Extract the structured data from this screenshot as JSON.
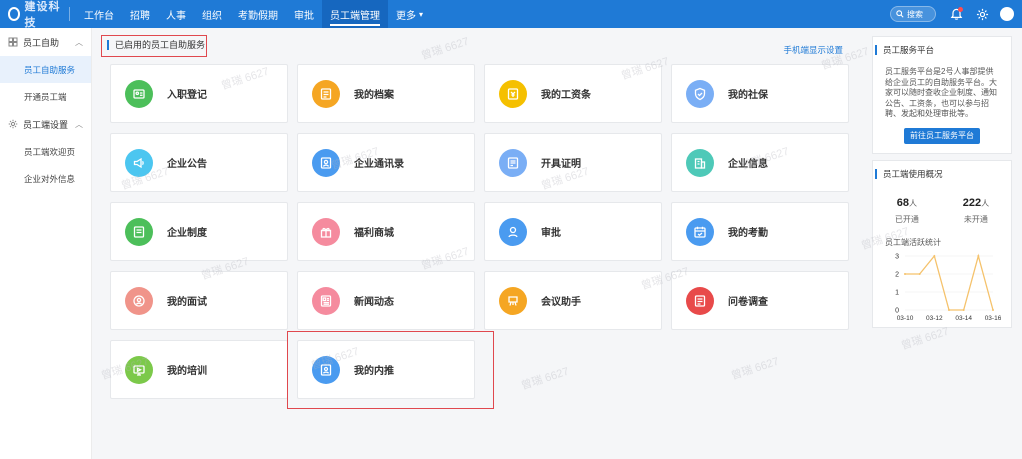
{
  "topbar": {
    "logo_text": "建设科技",
    "nav": [
      {
        "label": "工作台"
      },
      {
        "label": "招聘"
      },
      {
        "label": "人事"
      },
      {
        "label": "组织"
      },
      {
        "label": "考勤假期"
      },
      {
        "label": "审批"
      },
      {
        "label": "员工端管理",
        "active": true
      },
      {
        "label": "更多"
      }
    ],
    "search_label": "搜索"
  },
  "sidebar": {
    "groups": [
      {
        "label": "员工自助",
        "items": [
          "员工自助服务",
          "开通员工端"
        ]
      },
      {
        "label": "员工端设置",
        "items": [
          "员工端欢迎页",
          "企业对外信息"
        ]
      }
    ]
  },
  "main": {
    "section_title": "已启用的员工自助服务",
    "section_link": "手机端显示设置",
    "services": [
      {
        "label": "入职登记",
        "icon": "id-card-icon",
        "color": "#4cbf5a"
      },
      {
        "label": "我的档案",
        "icon": "folder-icon",
        "color": "#f5a623"
      },
      {
        "label": "我的工资条",
        "icon": "payslip-icon",
        "color": "#f5c000"
      },
      {
        "label": "我的社保",
        "icon": "shield-icon",
        "color": "#7aaef5"
      },
      {
        "label": "企业公告",
        "icon": "megaphone-icon",
        "color": "#4cc6f0"
      },
      {
        "label": "企业通讯录",
        "icon": "contacts-icon",
        "color": "#4a9bf0"
      },
      {
        "label": "开具证明",
        "icon": "certificate-icon",
        "color": "#7aaef5"
      },
      {
        "label": "企业信息",
        "icon": "company-icon",
        "color": "#4ec9b8"
      },
      {
        "label": "企业制度",
        "icon": "rules-icon",
        "color": "#4cbf5a"
      },
      {
        "label": "福利商城",
        "icon": "gift-icon",
        "color": "#f58b9e"
      },
      {
        "label": "审批",
        "icon": "approval-icon",
        "color": "#4a9bf0"
      },
      {
        "label": "我的考勤",
        "icon": "calendar-icon",
        "color": "#4a9bf0"
      },
      {
        "label": "我的面试",
        "icon": "interview-icon",
        "color": "#f0948a"
      },
      {
        "label": "新闻动态",
        "icon": "news-icon",
        "color": "#f58b9e"
      },
      {
        "label": "会议助手",
        "icon": "meeting-icon",
        "color": "#f5a623"
      },
      {
        "label": "问卷调查",
        "icon": "survey-icon",
        "color": "#e84a4a"
      },
      {
        "label": "我的培训",
        "icon": "training-icon",
        "color": "#7cc94a"
      },
      {
        "label": "我的内推",
        "icon": "referral-icon",
        "color": "#4a9bf0"
      }
    ]
  },
  "rpanel": {
    "platform": {
      "title": "员工服务平台",
      "desc": "员工服务平台是2号人事部提供给企业员工的自助服务平台。大家可以随时查收企业制度、通知公告、工资条，也可以参与招聘、发起和处理审批等。",
      "button": "前往员工服务平台"
    },
    "usage": {
      "title": "员工端使用概况",
      "opened": {
        "num": "68",
        "unit": "人",
        "label": "已开通"
      },
      "not_opened": {
        "num": "222",
        "unit": "人",
        "label": "未开通"
      },
      "chart_title": "员工端活跃统计"
    }
  },
  "chart_data": {
    "type": "line",
    "x": [
      "03-10",
      "03-11",
      "03-12",
      "03-13",
      "03-14",
      "03-15",
      "03-16"
    ],
    "x_tick_labels": [
      "03-10",
      "03-12",
      "03-14",
      "03-16"
    ],
    "series": [
      {
        "values": [
          2,
          2,
          3,
          0,
          0,
          3,
          0
        ]
      }
    ],
    "ylim": [
      0,
      3
    ],
    "y_ticks": [
      "0",
      "1",
      "2",
      "3"
    ],
    "color": "#f5c26b",
    "grid": true
  },
  "watermark_text": "曾瑞 6627"
}
